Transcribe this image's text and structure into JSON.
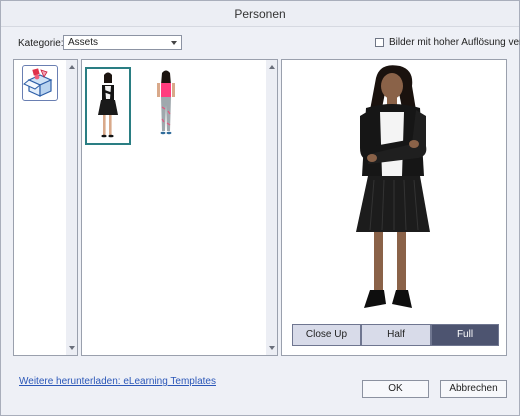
{
  "window": {
    "title": "Personen"
  },
  "category": {
    "label": "Kategorie:",
    "selected": "Assets"
  },
  "high_res": {
    "label": "Bilder mit hoher Auflösung verwenden",
    "checked": false
  },
  "thumbnails": [
    {
      "name": "woman-black-skirt",
      "selected": true
    },
    {
      "name": "woman-pink-top",
      "selected": false
    }
  ],
  "preview": {
    "buttons": [
      {
        "label": "Close Up",
        "active": false
      },
      {
        "label": "Half",
        "active": false
      },
      {
        "label": "Full",
        "active": true
      }
    ]
  },
  "footer": {
    "link_text": "Weitere herunterladen: eLearning Templates",
    "ok_label": "OK",
    "cancel_label": "Abbrechen"
  }
}
